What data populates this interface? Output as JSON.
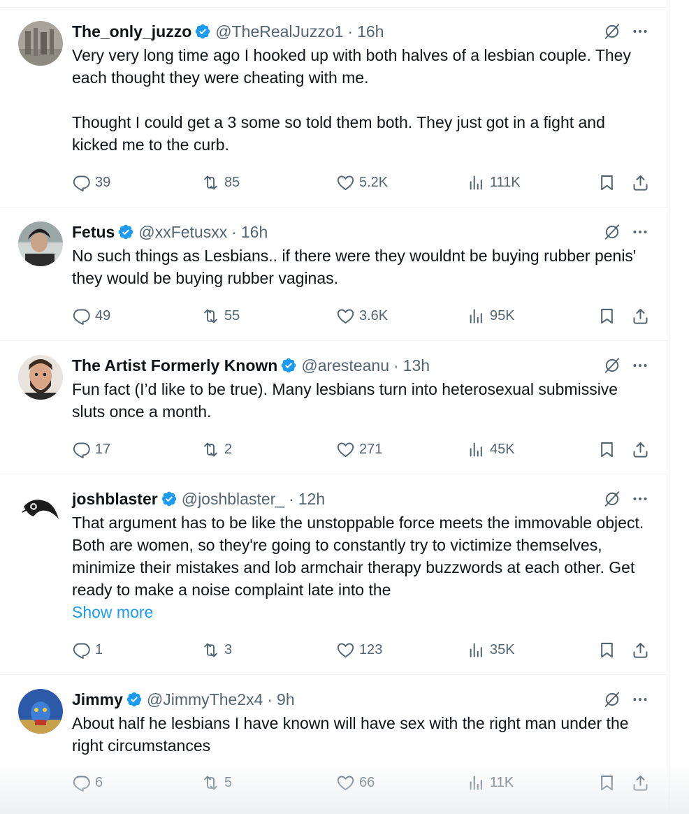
{
  "tweets": [
    {
      "name": "The_only_juzzo",
      "handle": "@TheRealJuzzo1",
      "dot": "·",
      "time": "16h",
      "text": "Very very long time ago I hooked up with both halves of a lesbian couple. They each thought they were cheating with me.\n\nThought I could get a 3 some so told them both. They just got in a fight and kicked me to the curb.",
      "show_more": "",
      "replies": "39",
      "reposts": "85",
      "likes": "5.2K",
      "views": "111K"
    },
    {
      "name": "Fetus",
      "handle": "@xxFetusxx",
      "dot": "·",
      "time": "16h",
      "text": "No such things as Lesbians.. if there were they wouldnt be buying rubber penis' they would be buying rubber vaginas.",
      "show_more": "",
      "replies": "49",
      "reposts": "55",
      "likes": "3.6K",
      "views": "95K"
    },
    {
      "name": "The Artist Formerly Known",
      "handle": "@aresteanu",
      "dot": "·",
      "time": "13h",
      "text": "Fun fact (I’d like to be true). Many lesbians turn into heterosexual submissive sluts once a month.",
      "show_more": "",
      "replies": "17",
      "reposts": "2",
      "likes": "271",
      "views": "45K"
    },
    {
      "name": "joshblaster",
      "handle": "@joshblaster_",
      "dot": "·",
      "time": "12h",
      "text": "That argument has to be like the unstoppable force meets the immovable object. Both are women, so they're going to constantly try to victimize themselves, minimize their mistakes and lob armchair therapy buzzwords at each other. Get ready to make a noise complaint late into the",
      "show_more": "Show more",
      "replies": "1",
      "reposts": "3",
      "likes": "123",
      "views": "35K"
    },
    {
      "name": "Jimmy",
      "handle": "@JimmyThe2x4",
      "dot": "·",
      "time": "9h",
      "text": "About half he lesbians I have known will have sex with the right man under the right circumstances",
      "show_more": "",
      "replies": "6",
      "reposts": "5",
      "likes": "66",
      "views": "11K"
    }
  ],
  "colors": {
    "text": "#0f1419",
    "secondary": "#536471",
    "verified": "#1d9bf0",
    "link": "#1d9bf0",
    "divider": "#eff3f4"
  }
}
